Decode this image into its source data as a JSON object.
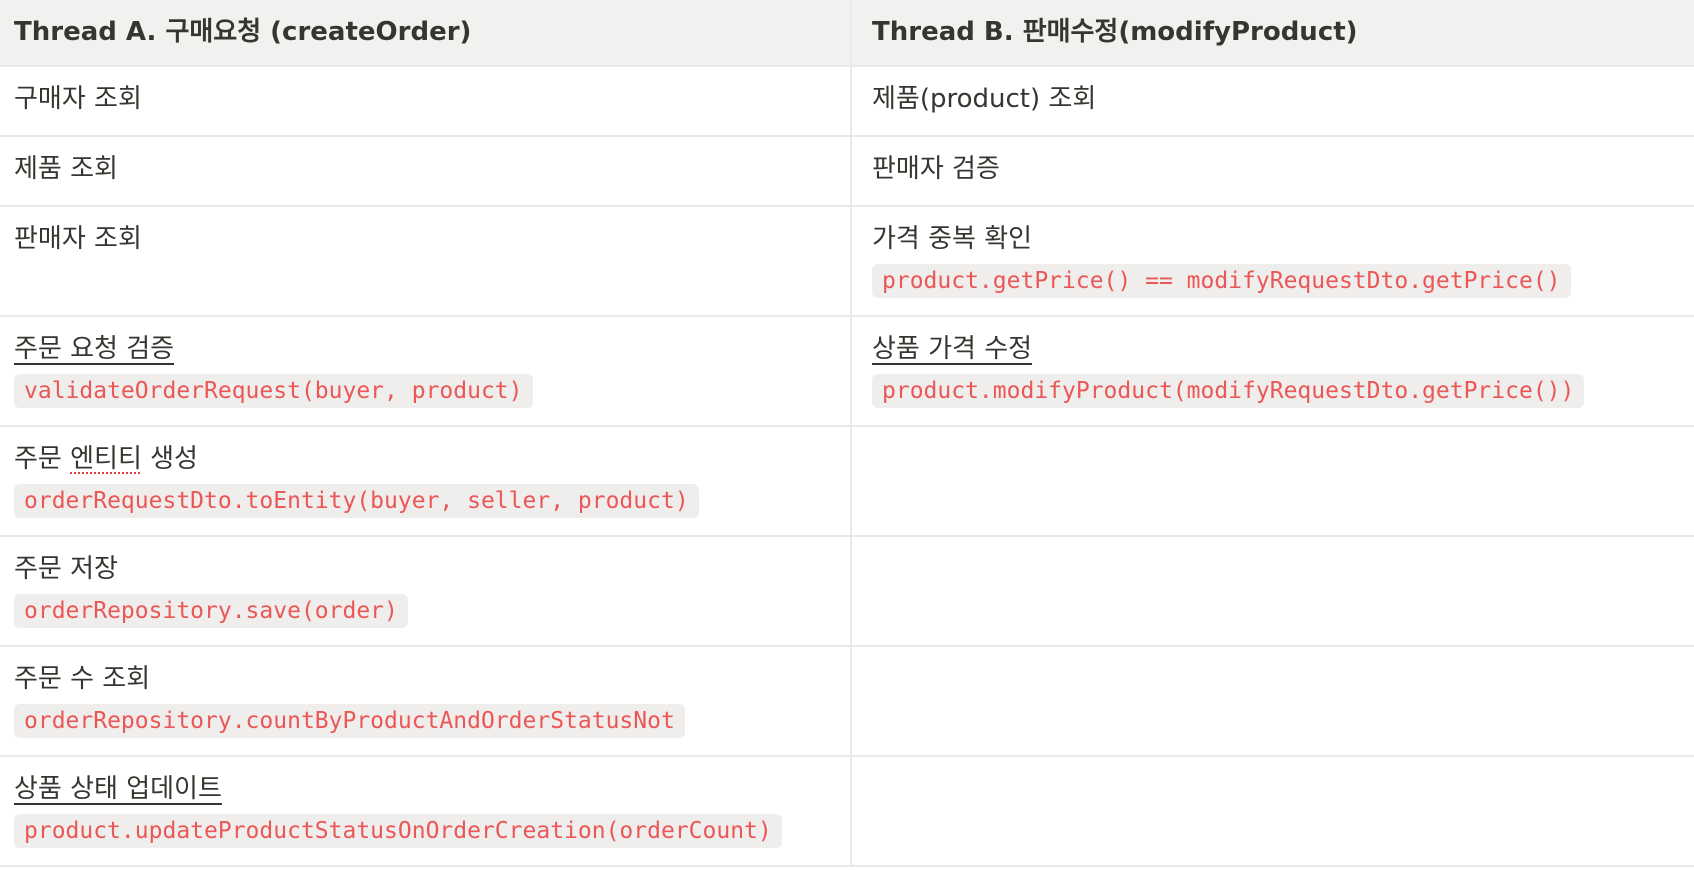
{
  "headers": {
    "thread_a": "Thread A. 구매요청 (createOrder)",
    "thread_b": "Thread B. 판매수정(modifyProduct)"
  },
  "rows": [
    {
      "a": {
        "title": "구매자 조회",
        "code": ""
      },
      "b": {
        "title": "제품(product) 조회",
        "code": ""
      }
    },
    {
      "a": {
        "title": "제품 조회",
        "code": ""
      },
      "b": {
        "title": "판매자 검증",
        "code": ""
      }
    },
    {
      "a": {
        "title": "판매자 조회",
        "code": ""
      },
      "b": {
        "title": "가격 중복 확인",
        "code": "product.getPrice() == modifyRequestDto.getPrice()"
      }
    },
    {
      "a": {
        "title": "주문 요청 검증",
        "code": "validateOrderRequest(buyer, product)"
      },
      "b": {
        "title": "상품 가격 수정",
        "code": "product.modifyProduct(modifyRequestDto.getPrice())"
      }
    },
    {
      "a": {
        "title_prefix": "주문 ",
        "title_squiggle": "엔티티",
        "title_suffix": " 생성",
        "code": "orderRequestDto.toEntity(buyer, seller, product)"
      },
      "b": {
        "title": "",
        "code": ""
      }
    },
    {
      "a": {
        "title": "주문 저장",
        "code": "orderRepository.save(order)"
      },
      "b": {
        "title": "",
        "code": ""
      }
    },
    {
      "a": {
        "title": "주문 수 조회",
        "code": "orderRepository.countByProductAndOrderStatusNot"
      },
      "b": {
        "title": "",
        "code": ""
      }
    },
    {
      "a": {
        "title": "상품 상태 업데이트",
        "code": "product.updateProductStatusOnOrderCreation(orderCount)"
      },
      "b": {
        "title": "",
        "code": ""
      }
    }
  ]
}
